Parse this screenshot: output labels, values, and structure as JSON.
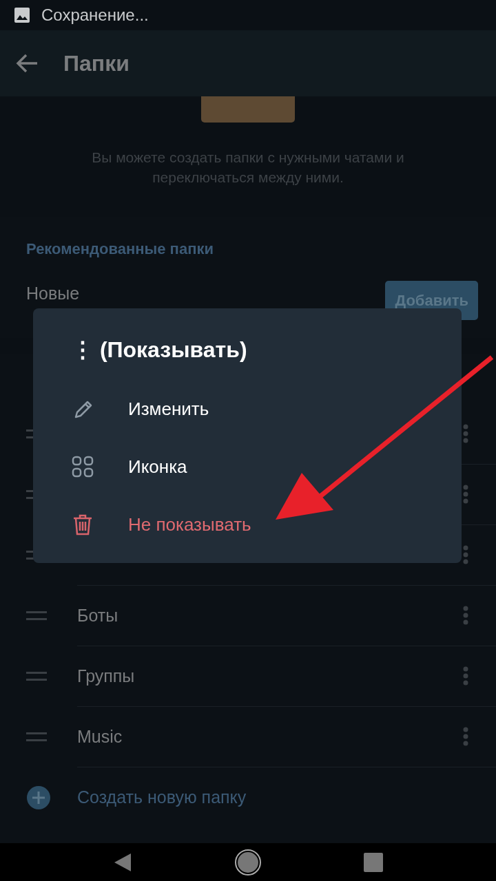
{
  "status_bar": {
    "notification": "Сохранение..."
  },
  "app_bar": {
    "title": "Папки"
  },
  "intro": {
    "description": "Вы можете создать папки с нужными чатами и переключаться между ними."
  },
  "recommended": {
    "header": "Рекомендованные папки",
    "folder": "Новые",
    "add_button": "Добавить"
  },
  "folders": [
    {
      "kind": "covered"
    },
    {
      "kind": "covered"
    },
    {
      "kind": "covered"
    },
    {
      "kind": "named",
      "name": "Боты"
    },
    {
      "kind": "named",
      "name": "Группы"
    },
    {
      "kind": "named",
      "name": "Music"
    }
  ],
  "create_button": "Создать новую папку",
  "menu": {
    "title": "⋮ (Показывать)",
    "items": [
      {
        "kind": "edit",
        "label": "Изменить"
      },
      {
        "kind": "icon",
        "label": "Иконка"
      },
      {
        "kind": "delete",
        "label": "Не показывать"
      }
    ]
  }
}
